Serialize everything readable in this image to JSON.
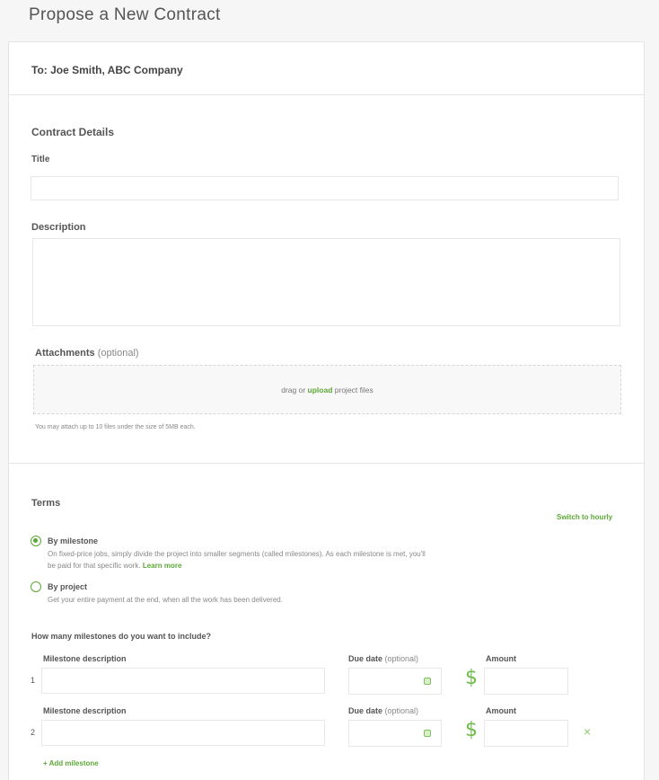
{
  "page": {
    "title": "Propose a New Contract"
  },
  "recipient": {
    "label": "To: Joe Smith, ABC Company"
  },
  "details": {
    "heading": "Contract Details",
    "title_label": "Title",
    "title_value": "",
    "description_label": "Description",
    "description_value": "",
    "attachments_label": "Attachments",
    "attachments_optional": "(optional)",
    "drop_prefix": "drag or",
    "drop_link": "upload",
    "drop_suffix": "project files",
    "attach_hint": "You may attach up to 10 files under the size of 5MB each."
  },
  "terms": {
    "heading": "Terms",
    "switch_link": "Switch to hourly",
    "options": [
      {
        "label": "By milestone",
        "selected": true,
        "description": "On fixed-price jobs, simply divide the project into smaller segments (called milestones). As each milestone is met, you'll be paid for that specific work.",
        "link": "Learn more"
      },
      {
        "label": "By project",
        "selected": false,
        "description": "Get your entire payment at the end, when all the work has been delivered."
      }
    ],
    "milestones_question": "How many milestones do you want to include?",
    "columns": {
      "description": "Milestone description",
      "due_date": "Due date",
      "due_optional": "(optional)",
      "amount": "Amount"
    },
    "currency_symbol": "$",
    "milestones": [
      {
        "number": "1",
        "description": "",
        "due_date": "",
        "amount": ""
      },
      {
        "number": "2",
        "description": "",
        "due_date": "",
        "amount": ""
      }
    ],
    "add_milestone": "+ Add milestone",
    "remove_icon": "×"
  },
  "colors": {
    "accent": "#5ca737",
    "background": "#f6f6f6",
    "border": "#e4e4e4"
  }
}
